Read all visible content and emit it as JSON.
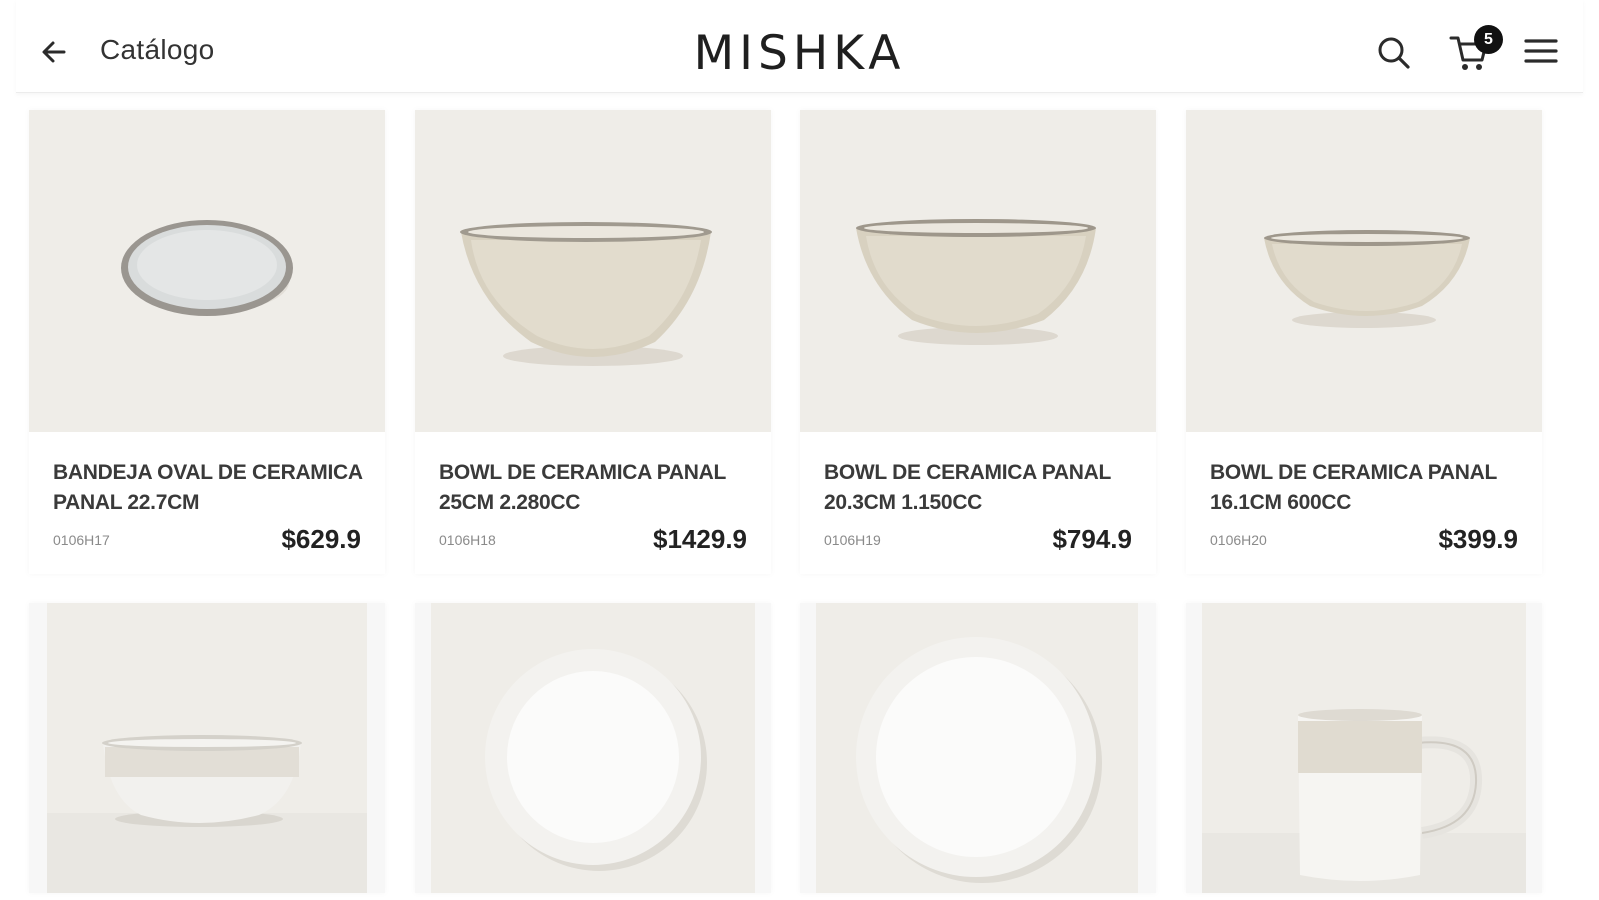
{
  "header": {
    "back_label": "Catálogo",
    "brand": "MISHKA",
    "cart_count": "5",
    "icons": [
      "arrow-left-icon",
      "search-icon",
      "cart-icon",
      "menu-icon"
    ]
  },
  "products": [
    {
      "name": "BANDEJA OVAL DE CERAMICA PANAL 22.7CM",
      "sku": "0106H17",
      "price": "$629.9"
    },
    {
      "name": "BOWL DE CERAMICA PANAL 25CM 2.280CC",
      "sku": "0106H18",
      "price": "$1429.9"
    },
    {
      "name": "BOWL DE CERAMICA PANAL 20.3CM 1.150CC",
      "sku": "0106H19",
      "price": "$794.9"
    },
    {
      "name": "BOWL DE CERAMICA PANAL 16.1CM 600CC",
      "sku": "0106H20",
      "price": "$399.9"
    }
  ],
  "colors": {
    "image_bg": "#efede8",
    "accent": "#111111"
  }
}
